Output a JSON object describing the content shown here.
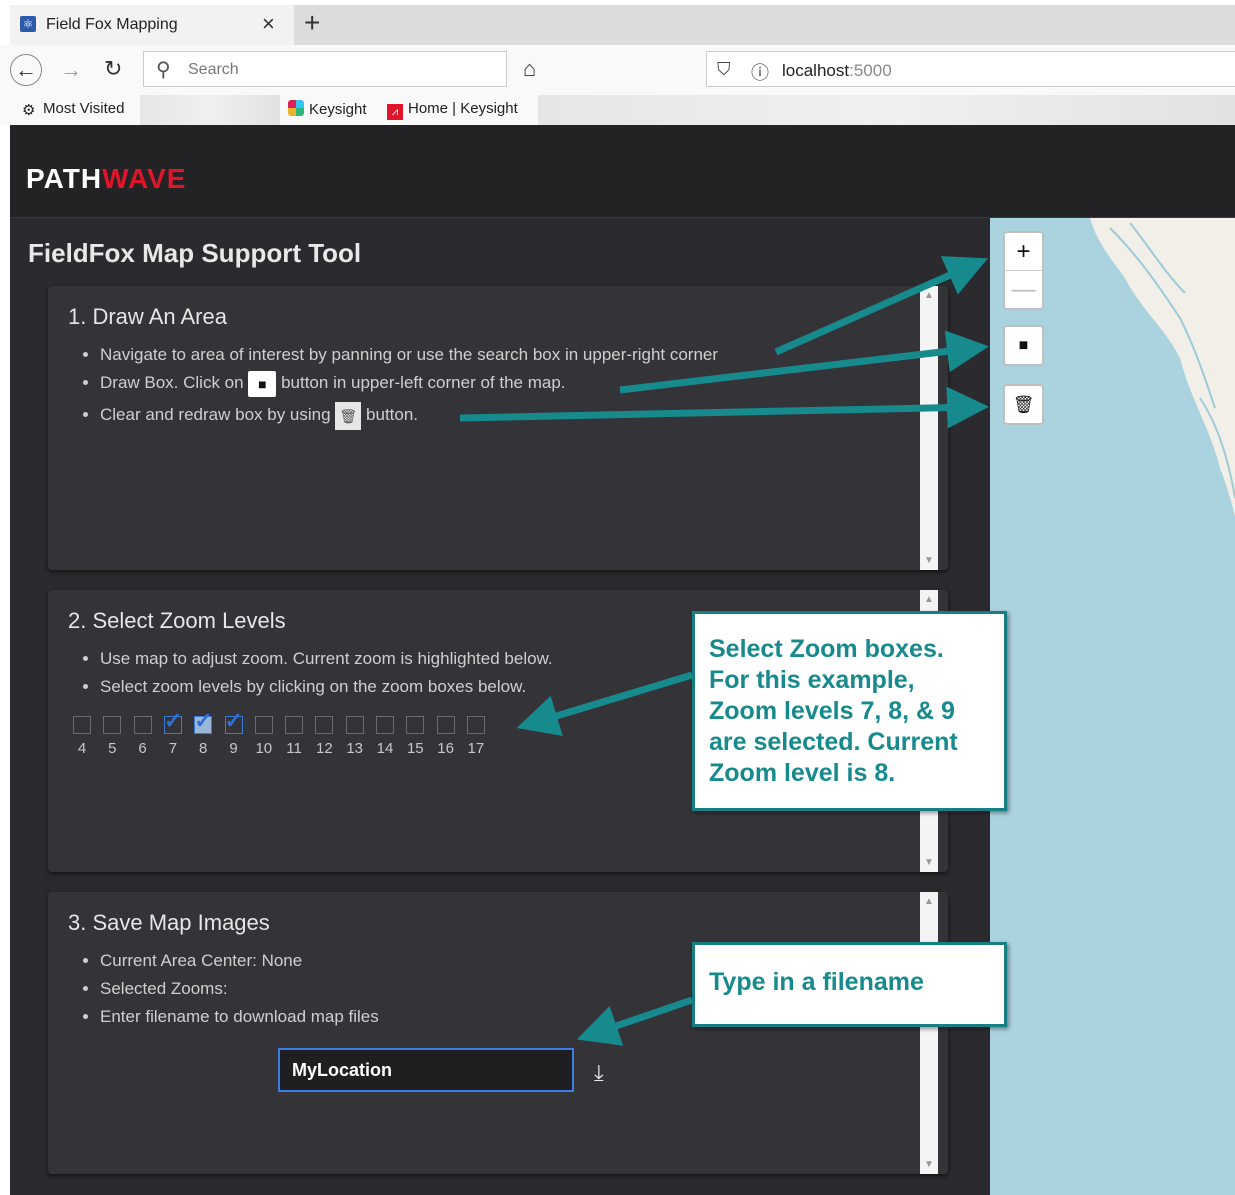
{
  "browser": {
    "tab_title": "Field Fox Mapping",
    "search_placeholder": "Search",
    "url_host": "localhost",
    "url_port": ":5000",
    "bookmarks": [
      {
        "label": "Most Visited"
      },
      {
        "label": "Keysight"
      },
      {
        "label": "Home | Keysight"
      }
    ]
  },
  "app": {
    "logo_part1": "PATH",
    "logo_part2": "WAVE",
    "title": "FieldFox Map Support Tool",
    "panel1": {
      "title": "1. Draw An Area",
      "bullet1": "Navigate to area of interest by panning or use the search box in upper-right corner",
      "bullet2_pre": "Draw Box. Click on",
      "bullet2_post": "button in upper-left corner of the map.",
      "bullet3_pre": "Clear and redraw box by using",
      "bullet3_post": "button."
    },
    "panel2": {
      "title": "2. Select Zoom Levels",
      "bullet1": "Use map to adjust zoom. Current zoom is highlighted below.",
      "bullet2": "Select zoom levels by clicking on the zoom boxes below.",
      "zoom_levels": [
        "4",
        "5",
        "6",
        "7",
        "8",
        "9",
        "10",
        "11",
        "12",
        "13",
        "14",
        "15",
        "16",
        "17"
      ],
      "selected_zooms": [
        "7",
        "8",
        "9"
      ],
      "current_zoom": "8"
    },
    "panel3": {
      "title": "3. Save Map Images",
      "bullet1": "Current Area Center: None",
      "bullet2": "Selected Zooms:",
      "bullet3": "Enter filename to download map files",
      "filename_value": "MyLocation"
    }
  },
  "map_controls": {
    "zoom_in": "+",
    "zoom_out": "—"
  },
  "callouts": {
    "zoom": [
      "Select Zoom boxes.",
      "For this example,",
      "Zoom levels 7, 8, & 9",
      "are selected. Current",
      "Zoom level is 8."
    ],
    "filename": "Type in a filename"
  },
  "colors": {
    "header_bg": "#232326",
    "panel_bg": "#333338",
    "logo_accent": "#e0142a",
    "callout_teal": "#178a8e",
    "map_water": "#aad3df",
    "checkbox_blue": "#2f6fd6"
  }
}
